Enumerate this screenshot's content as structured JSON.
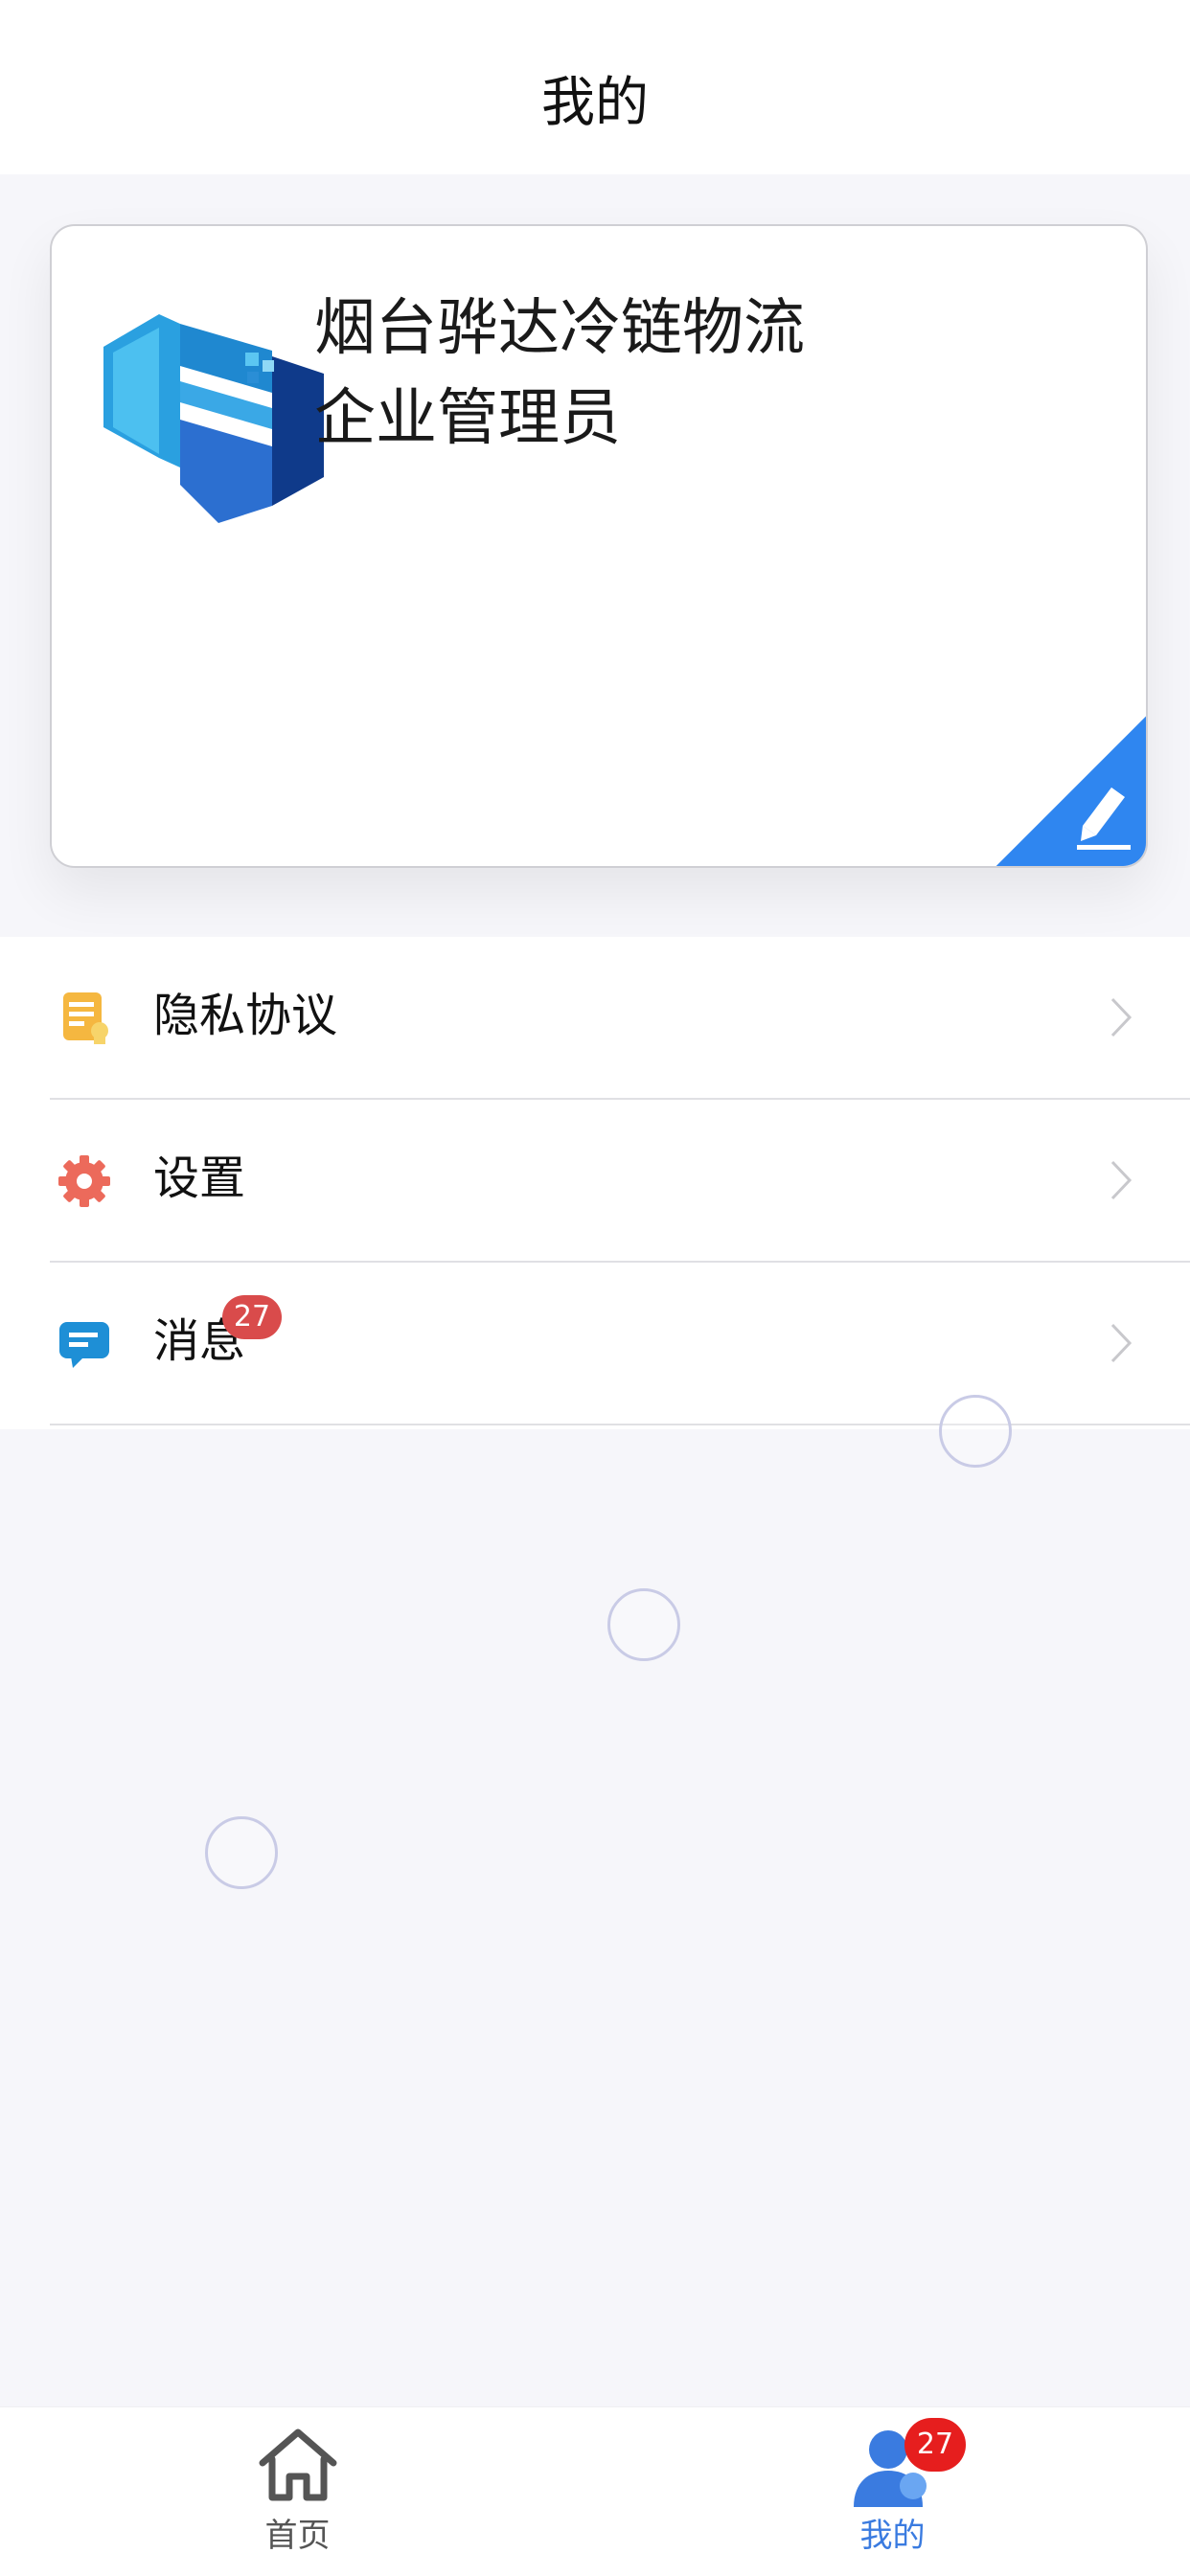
{
  "header": {
    "title": "我的"
  },
  "profile": {
    "company_name": "烟台骅达冷链物流",
    "role": "企业管理员"
  },
  "menu": {
    "items": [
      {
        "label": "隐私协议",
        "icon": "document-icon"
      },
      {
        "label": "设置",
        "icon": "gear-icon"
      },
      {
        "label": "消息",
        "icon": "message-icon",
        "badge": "27"
      }
    ]
  },
  "tabbar": {
    "tabs": [
      {
        "label": "首页",
        "icon": "home-icon",
        "active": false
      },
      {
        "label": "我的",
        "icon": "user-icon",
        "active": true,
        "badge": "27"
      }
    ]
  },
  "colors": {
    "accent": "#2f86f0",
    "badge_red": "#e61e1e",
    "message_badge": "#d94b4b",
    "tab_active": "#3a7be0",
    "tab_inactive": "#555555"
  }
}
